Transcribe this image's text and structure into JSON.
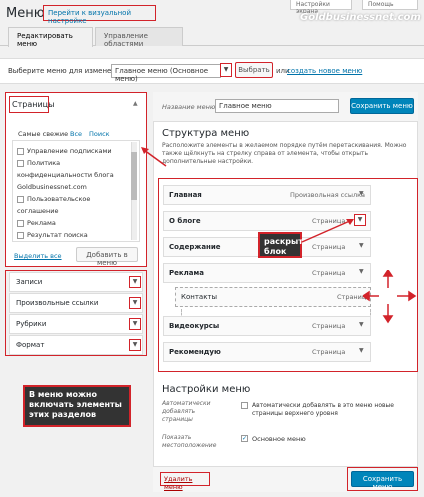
{
  "header": {
    "title": "Меню",
    "visual_link": "Перейти к визуальной настройке",
    "screen_options": "Настройки экрана",
    "help": "Помощь",
    "watermark": "Goldbusinessnet.com"
  },
  "tabs": [
    {
      "label": "Редактировать меню"
    },
    {
      "label": "Управление областями"
    }
  ],
  "selector": {
    "label": "Выберите меню для изменения:",
    "value": "Главное меню (Основное меню)",
    "select_button": "Выбрать",
    "or": "или",
    "create_link": "создать новое меню",
    "dot": "."
  },
  "pages_box": {
    "title": "Страницы",
    "tabs": [
      "Самые свежие",
      "Все",
      "Поиск"
    ],
    "items": [
      "Управление подписками",
      "Политика",
      "конфиденциальности блога",
      "Goldbusinessnet.com",
      "Пользовательское",
      "соглашение",
      "Реклама",
      "Результат поиска"
    ],
    "select_all": "Выделить все",
    "add_button": "Добавить в меню"
  },
  "sections": [
    {
      "label": "Записи"
    },
    {
      "label": "Произвольные ссылки"
    },
    {
      "label": "Рубрики"
    },
    {
      "label": "Формат"
    }
  ],
  "left_callout": "В меню можно включать элементы этих разделов",
  "menu": {
    "name_label": "Название меню",
    "name_value": "Главное меню",
    "save_button": "Сохранить меню",
    "structure_title": "Структура меню",
    "structure_hint": "Расположите элементы в желаемом порядке путём перетаскивания. Можно также щёлкнуть на стрелку справа от элемента, чтобы открыть дополнительные настройки.",
    "items": [
      {
        "title": "Главная",
        "type": "Произвольная ссылка"
      },
      {
        "title": "О блоге",
        "type": "Страница"
      },
      {
        "title": "Содержание",
        "type": "Страница"
      },
      {
        "title": "Реклама",
        "type": "Страница"
      },
      {
        "title": "Контакты",
        "type": "Страница"
      },
      {
        "title": "Видеокурсы",
        "type": "Страница"
      },
      {
        "title": "Рекомендую",
        "type": "Страница"
      }
    ],
    "expand_callout": "раскрыть блок",
    "settings_title": "Настройки меню",
    "auto_add_label": "Автоматически добавлять страницы",
    "auto_add_text": "Автоматически добавлять в это меню новые страницы верхнего уровня",
    "location_label": "Показать местоположение",
    "location_value": "Основное меню",
    "delete_link": "Удалить меню",
    "save_button_bottom": "Сохранить меню"
  },
  "icons": {
    "chevron": "▼",
    "collapse": "▲",
    "checkmark": "✓"
  }
}
